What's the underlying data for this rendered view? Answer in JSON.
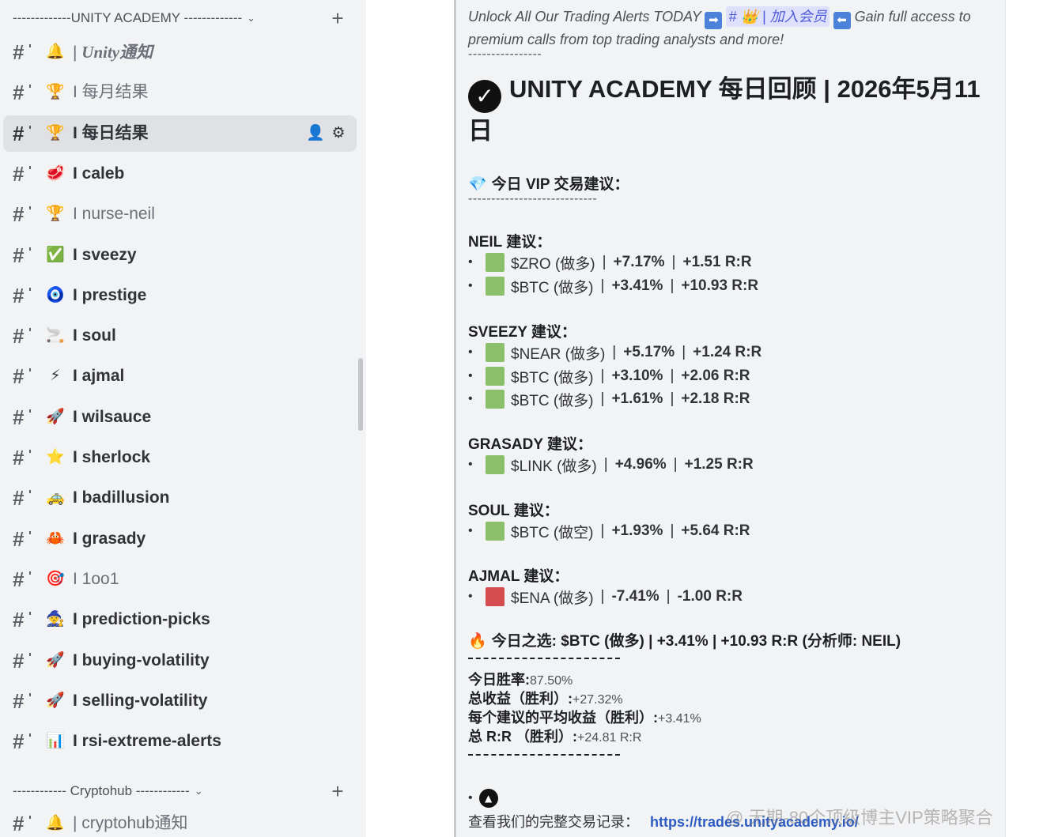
{
  "sidebar": {
    "category_1": {
      "label": "-------------UNITY ACADEMY -------------",
      "chevron": "chevron-down-icon",
      "add": "+"
    },
    "channels": [
      {
        "emoji": "🔔",
        "label": "| Unity通知",
        "style": "italic-muted"
      },
      {
        "emoji": "🏆",
        "label": "I 每月结果",
        "style": "muted"
      },
      {
        "emoji": "🏆",
        "label": "I 每日结果",
        "style": "active"
      },
      {
        "emoji": "🥩",
        "label": "I caleb",
        "style": "bold"
      },
      {
        "emoji": "🏆",
        "label": "I nurse-neil",
        "style": "muted"
      },
      {
        "emoji": "✅",
        "label": "I sveezy",
        "style": "bold"
      },
      {
        "emoji": "🧿",
        "label": "I prestige",
        "style": "bold"
      },
      {
        "emoji": "🚬",
        "label": "I soul",
        "style": "bold"
      },
      {
        "emoji": "⚡",
        "label": "I ajmal",
        "style": "bold"
      },
      {
        "emoji": "🚀",
        "label": "I wilsauce",
        "style": "bold"
      },
      {
        "emoji": "⭐",
        "label": "I sherlock",
        "style": "bold"
      },
      {
        "emoji": "🚕",
        "label": "I badillusion",
        "style": "bold"
      },
      {
        "emoji": "🦀",
        "label": "I grasady",
        "style": "bold"
      },
      {
        "emoji": "🎯",
        "label": "I 1oo1",
        "style": "muted"
      },
      {
        "emoji": "🧙",
        "label": "I prediction-picks",
        "style": "bold"
      },
      {
        "emoji": "🚀",
        "label": "I buying-volatility",
        "style": "bold"
      },
      {
        "emoji": "🚀",
        "label": "I selling-volatility",
        "style": "bold"
      },
      {
        "emoji": "📊",
        "label": "I rsi-extreme-alerts",
        "style": "bold"
      }
    ],
    "active_actions": {
      "invite": "add-member-icon",
      "settings": "gear-icon"
    },
    "category_2": {
      "label": "------------ Cryptohub ------------",
      "chevron": "chevron-down-icon",
      "add": "+"
    },
    "channels_2": [
      {
        "emoji": "🔔",
        "label": "| cryptohub通知",
        "style": "muted"
      }
    ]
  },
  "post": {
    "intro_text_1": "Unlock All Our Trading Alerts TODAY",
    "intro_chip": "# 👑 | 加入会员",
    "intro_text_2": "Gain full access to premium calls from top trading analysts and more!",
    "intro_dashes": "----------------",
    "title": "UNITY ACADEMY 每日回顾 | 2026年5月11日",
    "vip_heading": "今日 VIP 交易建议：",
    "vip_dashes": "----------------------------",
    "groups": [
      {
        "heading": "NEIL 建议：",
        "trades": [
          {
            "asset": "$ZRO (做多)",
            "pct": "+7.17%",
            "rr": "+1.51 R:R",
            "color": "green"
          },
          {
            "asset": "$BTC (做多)",
            "pct": "+3.41%",
            "rr": "+10.93 R:R",
            "color": "green"
          }
        ]
      },
      {
        "heading": "SVEEZY 建议：",
        "trades": [
          {
            "asset": "$NEAR (做多)",
            "pct": "+5.17%",
            "rr": "+1.24 R:R",
            "color": "green"
          },
          {
            "asset": "$BTC (做多)",
            "pct": "+3.10%",
            "rr": "+2.06 R:R",
            "color": "green"
          },
          {
            "asset": "$BTC (做多)",
            "pct": "+1.61%",
            "rr": "+2.18 R:R",
            "color": "green"
          }
        ]
      },
      {
        "heading": "GRASADY 建议：",
        "trades": [
          {
            "asset": "$LINK (做多)",
            "pct": "+4.96%",
            "rr": "+1.25 R:R",
            "color": "green"
          }
        ]
      },
      {
        "heading": "SOUL 建议：",
        "trades": [
          {
            "asset": "$BTC (做空)",
            "pct": "+1.93%",
            "rr": "+5.64 R:R",
            "color": "green"
          }
        ]
      },
      {
        "heading": "AJMAL 建议：",
        "trades": [
          {
            "asset": "$ENA (做多)",
            "pct": "-7.41%",
            "rr": "-1.00 R:R",
            "color": "red"
          }
        ]
      }
    ],
    "pick": "今日之选: $BTC (做多) | +3.41% | +10.93 R:R (分析师: NEIL)",
    "stats": [
      {
        "label": "今日胜率:",
        "value": "87.50%"
      },
      {
        "label": "总收益（胜利）:",
        "value": "+27.32%"
      },
      {
        "label": "每个建议的平均收益（胜利）:",
        "value": "+3.41%"
      },
      {
        "label": "总 R:R （胜利）:",
        "value": "+24.81 R:R"
      }
    ],
    "record_label": "查看我们的完整交易记录：",
    "record_link": "https://trades.unityacademy.io/",
    "watermark": "@ 无期-80个顶级博主VIP策略聚合"
  },
  "colors": {
    "green_square": "#8cbf6b",
    "red_square": "#d54c4e",
    "active_bg": "#dfe1e5",
    "sidebar_bg": "#f2f3f5",
    "link": "#2c5bc4",
    "chip_bg": "#dee0fc"
  }
}
